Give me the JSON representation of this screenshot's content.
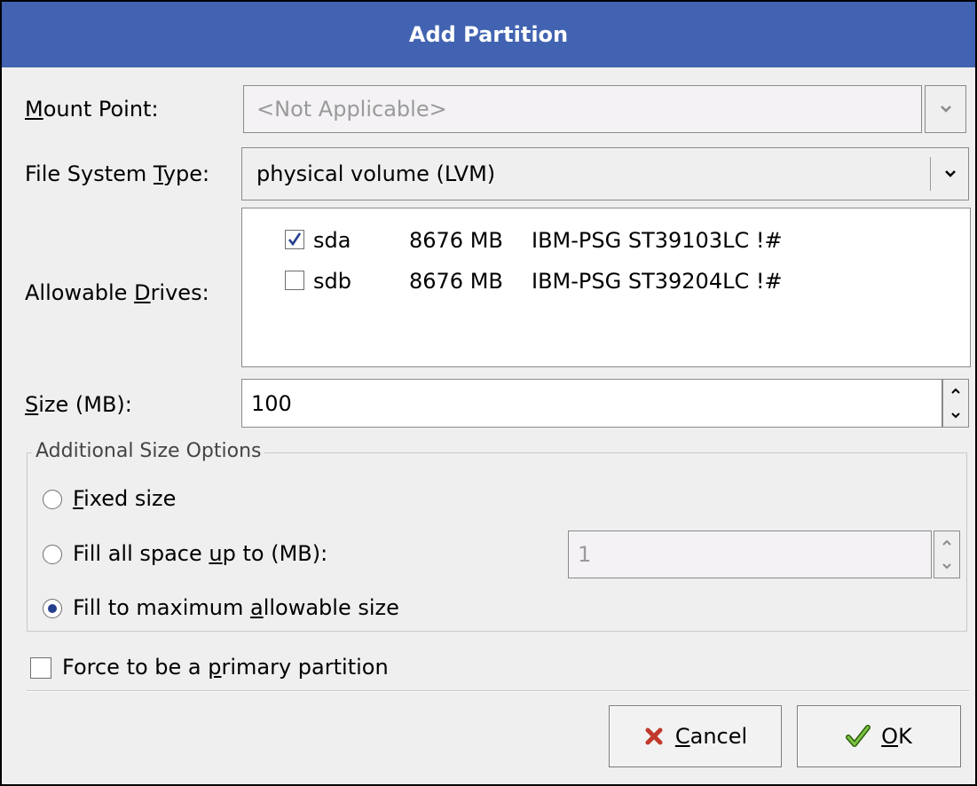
{
  "dialog": {
    "title": "Add Partition"
  },
  "mount_point": {
    "label_pre": "",
    "label_mn": "M",
    "label_post": "ount Point:",
    "value": "<Not Applicable>"
  },
  "fs_type": {
    "label_pre": "File System ",
    "label_mn": "T",
    "label_post": "ype:",
    "value": "physical volume (LVM)"
  },
  "drives": {
    "label_pre": "Allowable ",
    "label_mn": "D",
    "label_post": "rives:",
    "items": [
      {
        "checked": true,
        "name": "sda",
        "size": "8676 MB",
        "model": "IBM-PSG ST39103LC !#"
      },
      {
        "checked": false,
        "name": "sdb",
        "size": "8676 MB",
        "model": "IBM-PSG ST39204LC !#"
      }
    ]
  },
  "size": {
    "label_pre": "",
    "label_mn": "S",
    "label_post": "ize (MB):",
    "value": "100"
  },
  "size_options": {
    "title": "Additional Size Options",
    "fixed": {
      "pre": "",
      "mn": "F",
      "post": "ixed size",
      "selected": false
    },
    "fill_up_to": {
      "pre": "Fill all space ",
      "mn": "u",
      "post": "p to (MB):",
      "selected": false,
      "value": "1"
    },
    "fill_max": {
      "pre": "Fill to maximum ",
      "mn": "a",
      "post": "llowable size",
      "selected": true
    }
  },
  "force_primary": {
    "pre": "Force to be a ",
    "mn": "p",
    "post": "rimary partition",
    "checked": false
  },
  "buttons": {
    "cancel": {
      "pre": "",
      "mn": "C",
      "post": "ancel",
      "icon": "x-icon"
    },
    "ok": {
      "pre": "",
      "mn": "O",
      "post": "K",
      "icon": "checkmark-icon"
    }
  },
  "colors": {
    "titlebar": "#4263b1",
    "check": "#243f8c",
    "cancel_icon": "#c0392b",
    "ok_icon": "#58a81d"
  }
}
